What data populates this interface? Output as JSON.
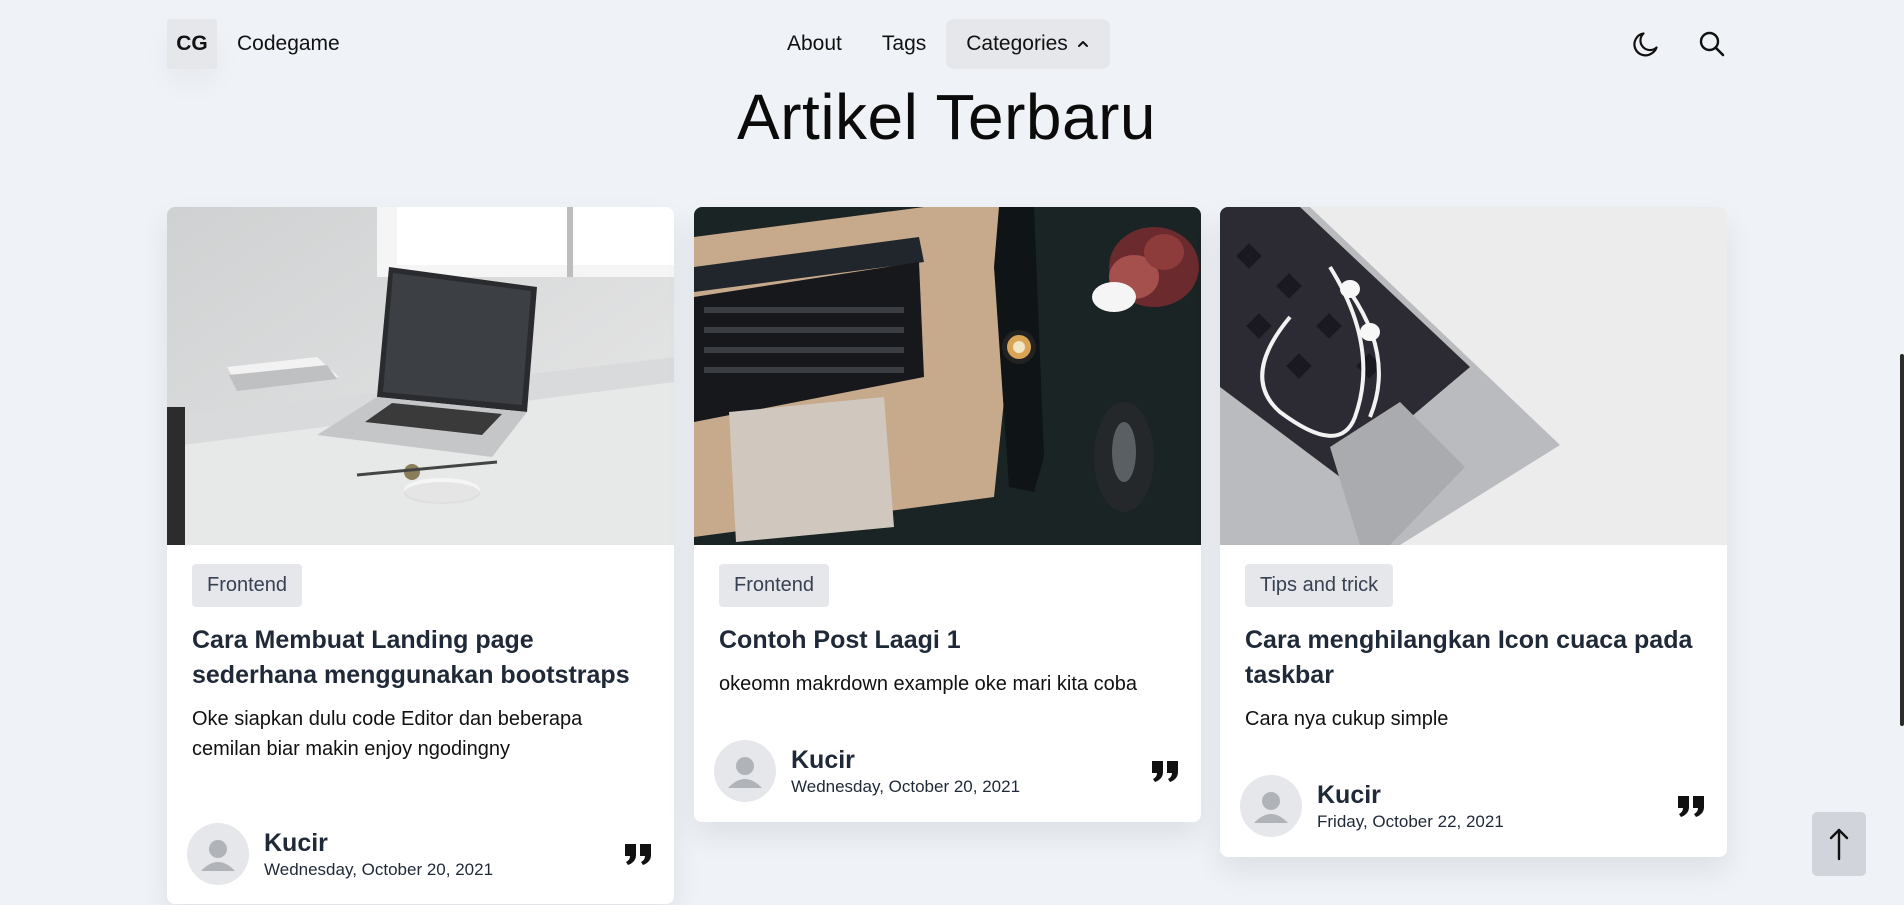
{
  "nav": {
    "logo": "CG",
    "brand": "Codegame",
    "menu": [
      {
        "label": "About"
      },
      {
        "label": "Tags"
      },
      {
        "label": "Categories"
      }
    ]
  },
  "heading": "Artikel Terbaru",
  "cards": [
    {
      "tag": "Frontend",
      "title": "Cara Membuat Landing page sederhana menggunakan bootstraps",
      "excerpt": "Oke siapkan dulu code Editor dan beberapa cemilan biar makin enjoy ngodingny",
      "author": "Kucir",
      "date": "Wednesday, October 20, 2021"
    },
    {
      "tag": "Frontend",
      "title": "Contoh Post Laagi 1",
      "excerpt": "okeomn makrdown example oke mari kita coba",
      "author": "Kucir",
      "date": "Wednesday, October 20, 2021"
    },
    {
      "tag": "Tips and trick",
      "title": "Cara menghilangkan Icon cuaca pada taskbar",
      "excerpt": "Cara nya cukup simple",
      "author": "Kucir",
      "date": "Friday, October 22, 2021"
    }
  ],
  "icons": {
    "theme_toggle": "moon-icon",
    "search": "search-icon",
    "categories_chevron": "chevron-up-icon",
    "quote": "quote-icon",
    "avatar": "user-avatar-icon",
    "to_top": "arrow-up-icon"
  },
  "colors": {
    "page_bg": "#eff3f8",
    "card_bg": "#ffffff",
    "tag_bg": "#e5e7eb",
    "title_text": "#1f2937",
    "active_menu_bg": "#e5e7eb"
  }
}
